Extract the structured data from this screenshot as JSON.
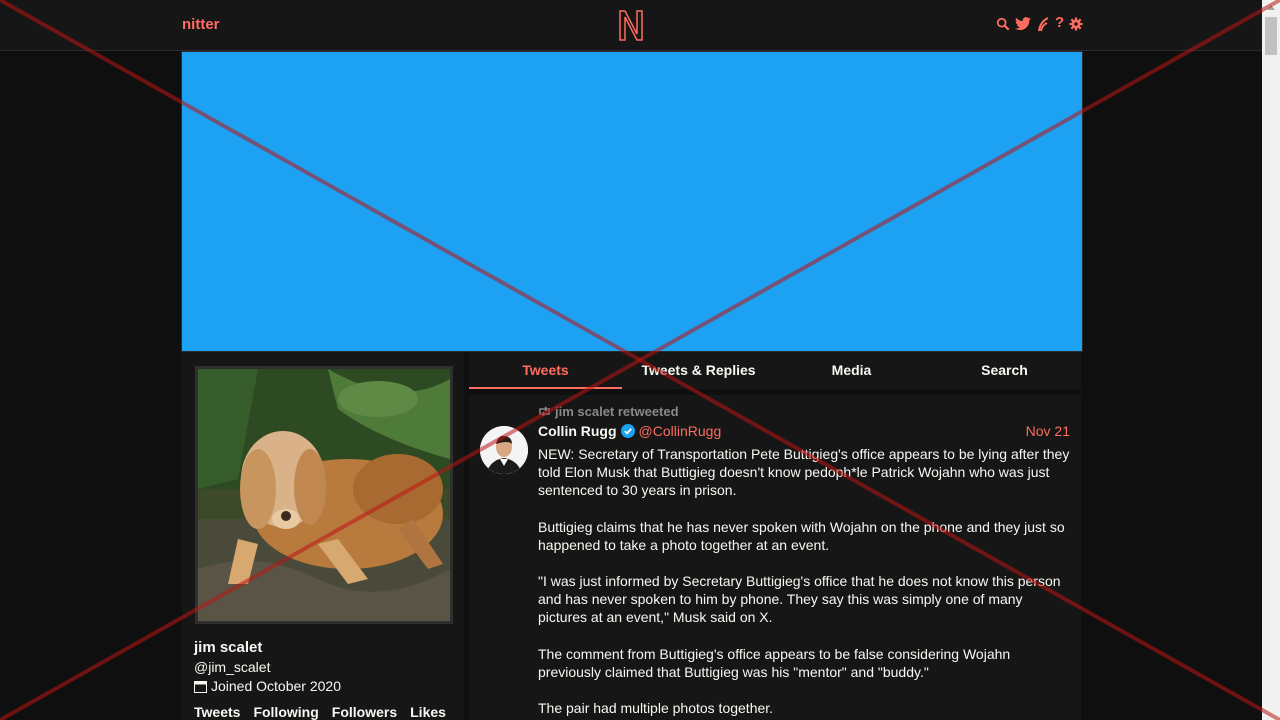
{
  "navbar": {
    "brand": "nitter",
    "icons": [
      "search-icon",
      "twitter-bird-icon",
      "rss-icon",
      "help-icon",
      "gear-icon"
    ],
    "help_label": "?"
  },
  "banner": {
    "color": "#1da1f2"
  },
  "profile": {
    "fullname": "jim scalet",
    "username": "@jim_scalet",
    "joined": "Joined October 2020",
    "stats": {
      "tweets": "Tweets",
      "following": "Following",
      "followers": "Followers",
      "likes": "Likes"
    }
  },
  "tabs": [
    {
      "label": "Tweets",
      "active": true
    },
    {
      "label": "Tweets & Replies",
      "active": false
    },
    {
      "label": "Media",
      "active": false
    },
    {
      "label": "Search",
      "active": false
    }
  ],
  "tweet": {
    "retweet_header": "jim scalet retweeted",
    "name": "Collin Rugg",
    "handle": "@CollinRugg",
    "date": "Nov 21",
    "paragraphs": [
      "NEW: Secretary of Transportation Pete Buttigieg's office appears to be lying after they told Elon Musk that Buttigieg doesn't know pedoph*le Patrick Wojahn who was just sentenced to 30 years in prison.",
      "Buttigieg claims that he has never spoken with Wojahn on the phone and they just so happened to take a photo together at an event.",
      "\"I was just informed by Secretary Buttigieg's office that he does not know this person and has never spoken to him by phone. They say this was simply one of many pictures at an event,\" Musk said on X.",
      "The comment from Buttigieg's office appears to be false considering Wojahn previously claimed that Buttigieg was his \"mentor\" and \"buddy.\"",
      "The pair had multiple photos together."
    ]
  },
  "colors": {
    "accent": "#ff6c60",
    "background": "#0f0f0f",
    "panel": "#161616",
    "text": "#f8f8f2",
    "muted": "#888889",
    "verified": "#1da1f2"
  }
}
